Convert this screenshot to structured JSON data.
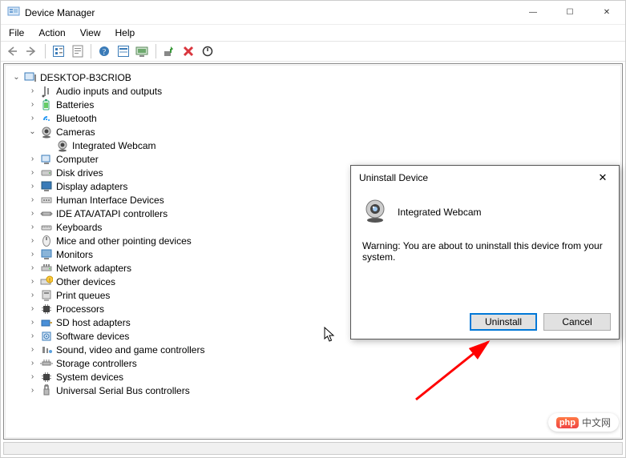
{
  "window": {
    "title": "Device Manager"
  },
  "win_controls": {
    "min": "—",
    "max": "☐",
    "close": "✕"
  },
  "menu": {
    "file": "File",
    "action": "Action",
    "view": "View",
    "help": "Help"
  },
  "tree": {
    "root": {
      "label": "DESKTOP-B3CRIOB"
    },
    "items": [
      {
        "label": "Audio inputs and outputs"
      },
      {
        "label": "Batteries"
      },
      {
        "label": "Bluetooth"
      },
      {
        "label": "Cameras",
        "expanded": true,
        "children": [
          {
            "label": "Integrated Webcam"
          }
        ]
      },
      {
        "label": "Computer"
      },
      {
        "label": "Disk drives"
      },
      {
        "label": "Display adapters"
      },
      {
        "label": "Human Interface Devices"
      },
      {
        "label": "IDE ATA/ATAPI controllers"
      },
      {
        "label": "Keyboards"
      },
      {
        "label": "Mice and other pointing devices"
      },
      {
        "label": "Monitors"
      },
      {
        "label": "Network adapters"
      },
      {
        "label": "Other devices"
      },
      {
        "label": "Print queues"
      },
      {
        "label": "Processors"
      },
      {
        "label": "SD host adapters"
      },
      {
        "label": "Software devices"
      },
      {
        "label": "Sound, video and game controllers"
      },
      {
        "label": "Storage controllers"
      },
      {
        "label": "System devices"
      },
      {
        "label": "Universal Serial Bus controllers"
      }
    ]
  },
  "dialog": {
    "title": "Uninstall Device",
    "device": "Integrated Webcam",
    "warning": "Warning: You are about to uninstall this device from your system.",
    "ok": "Uninstall",
    "cancel": "Cancel"
  },
  "watermark": {
    "brand": "php",
    "text": "中文网"
  }
}
